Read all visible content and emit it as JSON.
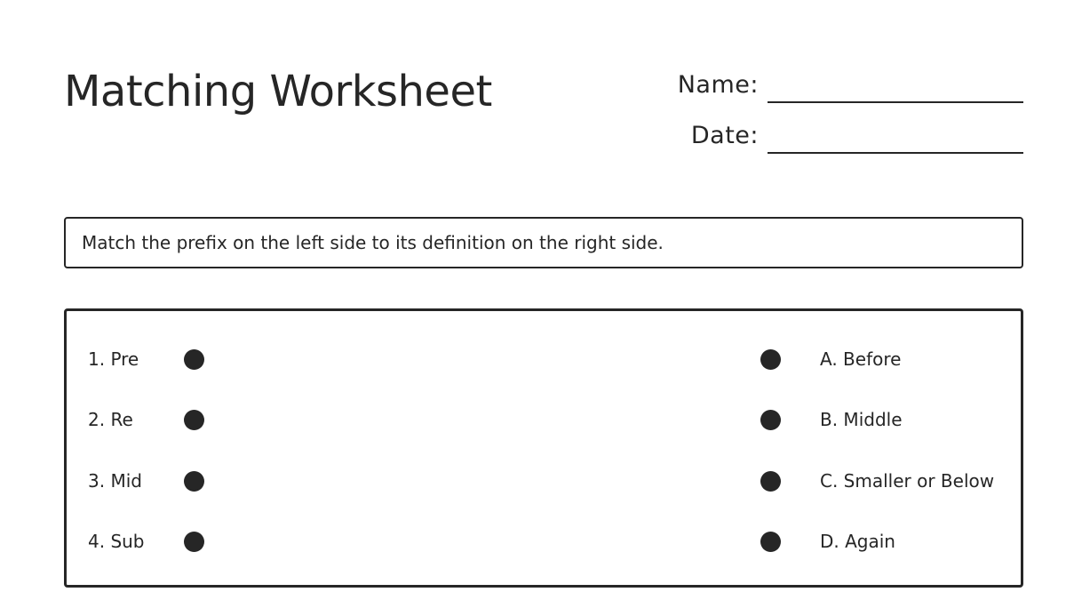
{
  "worksheet": {
    "title": "Matching Worksheet",
    "name_label": "Name:",
    "date_label": "Date:",
    "instructions": "Match the prefix on the left side to its definition on the right side.",
    "prefixes": [
      "1. Pre",
      "2. Re",
      "3. Mid",
      "4. Sub"
    ],
    "definitions": [
      "A. Before",
      "B. Middle",
      "C. Smaller or Below",
      "D. Again"
    ]
  },
  "colors": {
    "ink": "#262626",
    "background": "#ffffff"
  }
}
